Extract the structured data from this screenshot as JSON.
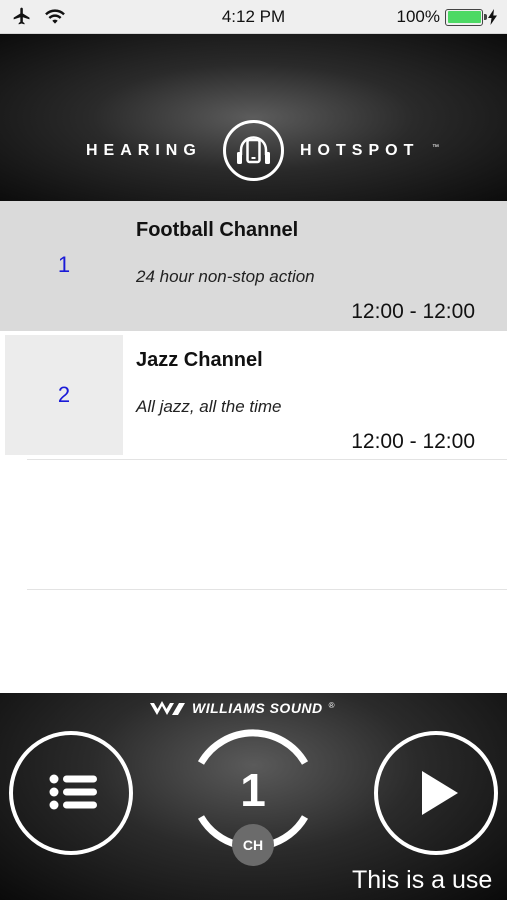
{
  "status_bar": {
    "time": "4:12 PM",
    "battery": "100%",
    "icons": [
      "airplane-icon",
      "wifi-icon",
      "battery-icon",
      "charging-icon"
    ]
  },
  "header": {
    "brand_left": "HEARING",
    "brand_right": "HOTSPOT",
    "trademark": "™"
  },
  "channels": [
    {
      "number": "1",
      "name": "Football Channel",
      "description": "24 hour non-stop action",
      "time": "12:00 - 12:00"
    },
    {
      "number": "2",
      "name": "Jazz Channel",
      "description": "All jazz, all the time",
      "time": "12:00 - 12:00"
    }
  ],
  "footer": {
    "brand": "WILLIAMS SOUND",
    "brand_reg": "®",
    "current_channel": "1",
    "channel_label": "CH",
    "ticker": "This is a use"
  },
  "colors": {
    "channel_number": "#1a1ad8",
    "selected_row": "#dadada",
    "battery": "#4cd964"
  }
}
